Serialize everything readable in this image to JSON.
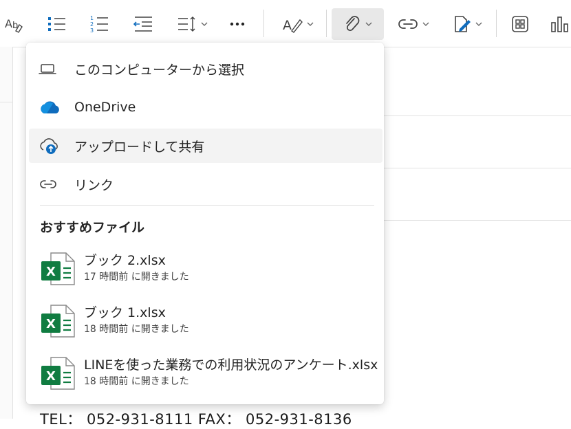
{
  "toolbar": {
    "buttons": [
      {
        "name": "spelling-icon"
      },
      {
        "name": "bullet-list-icon"
      },
      {
        "name": "numbered-list-icon"
      },
      {
        "name": "decrease-indent-icon"
      },
      {
        "name": "line-spacing-icon"
      },
      {
        "name": "more-icon"
      },
      {
        "name": "styles-icon"
      },
      {
        "name": "attach-file-icon",
        "active": true
      },
      {
        "name": "link-icon"
      },
      {
        "name": "signature-icon"
      },
      {
        "name": "apps-icon"
      },
      {
        "name": "chart-icon"
      }
    ]
  },
  "attach_menu": {
    "items": [
      {
        "icon": "laptop-icon",
        "label": "このコンピューターから選択"
      },
      {
        "icon": "onedrive-icon",
        "label": "OneDrive"
      },
      {
        "icon": "cloud-upload-icon",
        "label": "アップロードして共有"
      },
      {
        "icon": "link-icon",
        "label": "リンク"
      }
    ],
    "recommended_title": "おすすめファイル",
    "files": [
      {
        "name": "ブック 2.xlsx",
        "meta": "17 時間前 に開きました",
        "icon": "excel-icon"
      },
      {
        "name": "ブック 1.xlsx",
        "meta": "18 時間前 に開きました",
        "icon": "excel-icon"
      },
      {
        "name": "LINEを使った業務での利用状況のアンケート.xlsx",
        "meta": "18 時間前 に開きました",
        "icon": "excel-icon"
      }
    ]
  },
  "document": {
    "footer_text": "TEL： 052-931-8111 FAX： 052-931-8136"
  },
  "colors": {
    "excel_green": "#107c41",
    "onedrive_blue": "#0f6cbd",
    "hover_bg": "#f3f3f3"
  }
}
